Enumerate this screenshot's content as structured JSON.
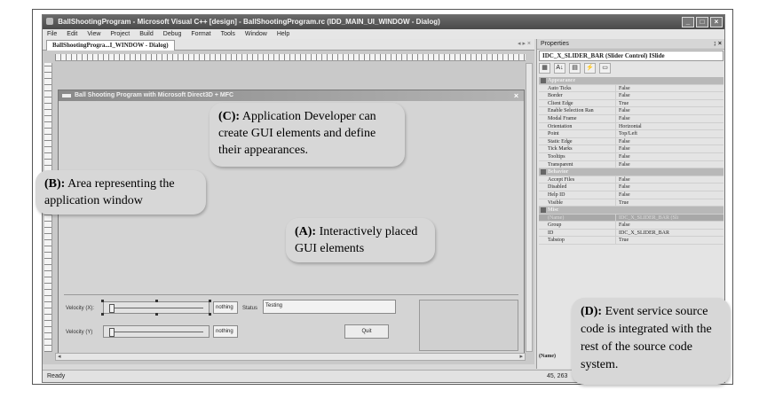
{
  "window": {
    "title": "BallShootingProgram - Microsoft Visual C++ [design] - BallShootingProgram.rc (IDD_MAIN_UI_WINDOW - Dialog)",
    "min": "_",
    "max": "□",
    "close": "×"
  },
  "menu": [
    "File",
    "Edit",
    "View",
    "Project",
    "Build",
    "Debug",
    "Format",
    "Tools",
    "Window",
    "Help"
  ],
  "doc_tab": {
    "label": "BallShootingProgra...I_WINDOW - Dialog)",
    "controls": "◂ ▸ ×"
  },
  "dialog": {
    "title": "Ball Shooting Program with Microsoft Direct3D + MFC",
    "close": "×",
    "velocity_x_label": "Velocity (X):",
    "velocity_y_label": "Velocity (Y)",
    "nothing_1": "nothing",
    "nothing_2": "nothing",
    "status_label": "Status",
    "status_value": "Testing",
    "quit": "Quit"
  },
  "statusbar": {
    "text": "Ready",
    "coords": "45, 263"
  },
  "properties": {
    "title": "Properties",
    "pin": "↨ ×",
    "selected_object": "IDC_X_SLIDER_BAR (Slider Control) ISlide",
    "tools": [
      "▦",
      "A↓",
      "▤",
      "⚡",
      "▭"
    ],
    "rows": [
      {
        "cat": true,
        "name": "Appearance"
      },
      {
        "name": "Auto Ticks",
        "value": "False"
      },
      {
        "name": "Border",
        "value": "False"
      },
      {
        "name": "Client Edge",
        "value": "True"
      },
      {
        "name": "Enable Selection Ran",
        "value": "False"
      },
      {
        "name": "Modal Frame",
        "value": "False"
      },
      {
        "name": "Orientation",
        "value": "Horizontal"
      },
      {
        "name": "Point",
        "value": "Top/Left"
      },
      {
        "name": "Static Edge",
        "value": "False"
      },
      {
        "name": "Tick Marks",
        "value": "False"
      },
      {
        "name": "Tooltips",
        "value": "False"
      },
      {
        "name": "Transparent",
        "value": "False"
      },
      {
        "cat": true,
        "name": "Behavior"
      },
      {
        "name": "Accept Files",
        "value": "False"
      },
      {
        "name": "Disabled",
        "value": "False"
      },
      {
        "name": "Help ID",
        "value": "False"
      },
      {
        "name": "Visible",
        "value": "True"
      },
      {
        "cat": true,
        "name": "Misc"
      },
      {
        "sel": true,
        "name": "(Name)",
        "value": "IDC_X_SLIDER_BAR (Sli"
      },
      {
        "name": "Group",
        "value": "False"
      },
      {
        "name": "ID",
        "value": "IDC_X_SLIDER_BAR"
      },
      {
        "name": "Tabstop",
        "value": "True"
      }
    ],
    "desc": "(Name)"
  },
  "annotations": {
    "A": {
      "key": "(A):",
      "text": "Interactively placed GUI elements"
    },
    "B": {
      "key": "(B):",
      "text": "Area representing the application window"
    },
    "C": {
      "key": "(C):",
      "text": "Application Developer can create GUI elements and define their appearances."
    },
    "D": {
      "key": "(D):",
      "text": "Event service source code is integrated with the rest of the source code system."
    }
  },
  "colors": {
    "bubble": "#d7d7d7",
    "titlebar": "#4a4a4a",
    "dialog_face": "#d4d4d4"
  }
}
